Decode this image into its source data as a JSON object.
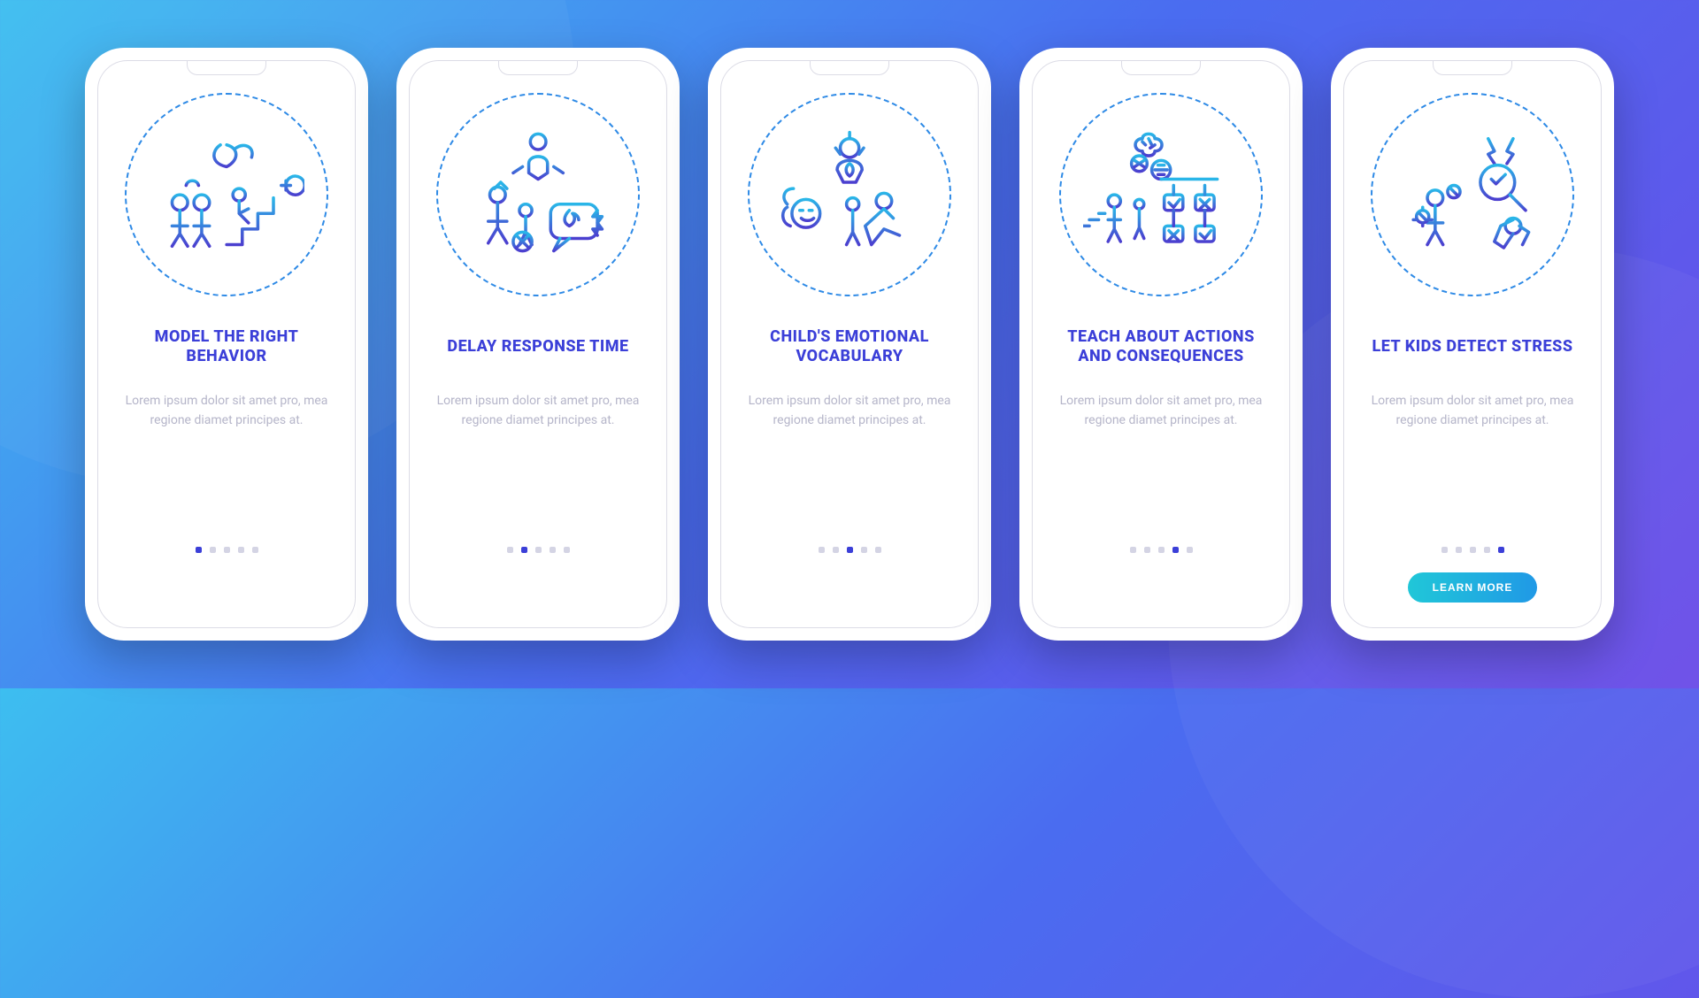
{
  "screens": [
    {
      "icon": "model-behavior-icon",
      "title": "MODEL THE RIGHT BEHAVIOR",
      "body": "Lorem ipsum dolor sit amet pro, mea regione diamet principes at.",
      "activeDot": 0,
      "showCta": false
    },
    {
      "icon": "delay-response-icon",
      "title": "DELAY RESPONSE TIME",
      "body": "Lorem ipsum dolor sit amet pro, mea regione diamet principes at.",
      "activeDot": 1,
      "showCta": false
    },
    {
      "icon": "emotional-vocabulary-icon",
      "title": "CHILD'S EMOTIONAL VOCABULARY",
      "body": "Lorem ipsum dolor sit amet pro, mea regione diamet principes at.",
      "activeDot": 2,
      "showCta": false
    },
    {
      "icon": "actions-consequences-icon",
      "title": "TEACH ABOUT ACTIONS AND CONSEQUENCES",
      "body": "Lorem ipsum dolor sit amet pro, mea regione diamet principes at.",
      "activeDot": 3,
      "showCta": false
    },
    {
      "icon": "detect-stress-icon",
      "title": "LET KIDS DETECT STRESS",
      "body": "Lorem ipsum dolor sit amet pro, mea regione diamet principes at.",
      "activeDot": 4,
      "showCta": true
    }
  ],
  "dotCount": 5,
  "ctaLabel": "LEARN MORE",
  "colors": {
    "gradientStart": "#29b6e8",
    "gradientEnd": "#4b3fcf",
    "titleColor": "#3b3fd8",
    "bodyColor": "#b5b5c9"
  }
}
